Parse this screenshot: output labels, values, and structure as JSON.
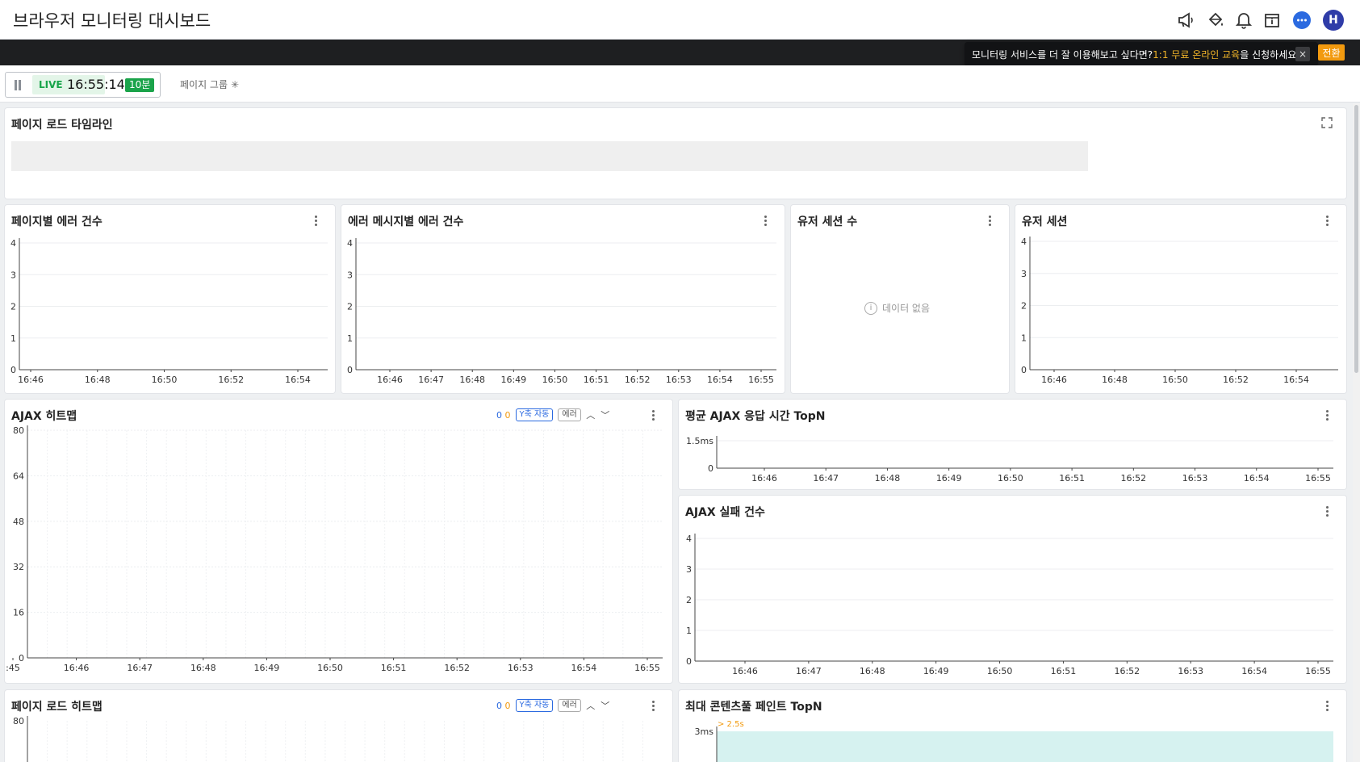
{
  "header": {
    "title": "브라우저 모니터링 대시보드",
    "icons": [
      "megaphone-icon",
      "paint-bucket-icon",
      "bell-icon",
      "calendar-icon",
      "chat-icon"
    ],
    "avatar_letter": "H"
  },
  "toast": {
    "text_before": "모니터링 서비스를 더 잘 이용해보고 싶다면? ",
    "highlight": "1:1 무료 온라인 교육",
    "text_after": "을 신청하세요",
    "close": "×",
    "side_button": "전환"
  },
  "toolbar": {
    "live_label": "LIVE",
    "time": "16:55:14",
    "range": "10분",
    "page_group_label": "페이지 그룹",
    "page_group_icon": "✳"
  },
  "cards": {
    "timeline": {
      "title": "페이지 로드 타임라인"
    },
    "page_errors": {
      "title": "페이지별 에러 건수"
    },
    "msg_errors": {
      "title": "에러 메시지별 에러 건수"
    },
    "session_count": {
      "title": "유저 세션 수",
      "no_data": "데이터 없음"
    },
    "sessions": {
      "title": "유저 세션"
    },
    "ajax_heatmap": {
      "title": "AJAX 히트맵",
      "count_a": "0",
      "count_b": "0",
      "y_auto": "Y축 자동",
      "error": "에러"
    },
    "ajax_avg": {
      "title": "평균 AJAX 응답 시간 TopN"
    },
    "ajax_fail": {
      "title": "AJAX 실패 건수"
    },
    "pl_heatmap": {
      "title": "페이지 로드 히트맵",
      "count_a": "0",
      "count_b": "0",
      "y_auto": "Y축 자동",
      "error": "에러"
    },
    "lcp": {
      "title": "최대 콘텐츠풀 페인트 TopN",
      "threshold": "> 2.5s"
    }
  },
  "chart_data": [
    {
      "type": "line",
      "name": "페이지별 에러 건수",
      "x": [
        "16:46",
        "16:48",
        "16:50",
        "16:52",
        "16:54"
      ],
      "ylim": [
        0,
        4
      ],
      "yticks": [
        "0",
        "1",
        "2",
        "3",
        "4"
      ],
      "series": []
    },
    {
      "type": "line",
      "name": "에러 메시지별 에러 건수",
      "x": [
        "16:46",
        "16:47",
        "16:48",
        "16:49",
        "16:50",
        "16:51",
        "16:52",
        "16:53",
        "16:54",
        "16:55"
      ],
      "ylim": [
        0,
        4
      ],
      "yticks": [
        "0",
        "1",
        "2",
        "3",
        "4"
      ],
      "series": []
    },
    {
      "type": "line",
      "name": "유저 세션",
      "x": [
        "16:46",
        "16:48",
        "16:50",
        "16:52",
        "16:54"
      ],
      "ylim": [
        0,
        4
      ],
      "yticks": [
        "0",
        "1",
        "2",
        "3",
        "4"
      ],
      "series": []
    },
    {
      "type": "heatmap",
      "name": "AJAX 히트맵",
      "x": [
        ":45",
        "16:46",
        "16:47",
        "16:48",
        "16:49",
        "16:50",
        "16:51",
        "16:52",
        "16:53",
        "16:54",
        "16:55"
      ],
      "ylim": [
        0,
        80
      ],
      "yticks": [
        "0",
        "16",
        "32",
        "48",
        "64",
        "80"
      ],
      "values": []
    },
    {
      "type": "line",
      "name": "평균 AJAX 응답 시간 TopN",
      "x": [
        "16:46",
        "16:47",
        "16:48",
        "16:49",
        "16:50",
        "16:51",
        "16:52",
        "16:53",
        "16:54",
        "16:55"
      ],
      "yticks": [
        "0",
        "1.5ms"
      ],
      "series": []
    },
    {
      "type": "line",
      "name": "AJAX 실패 건수",
      "x": [
        "16:46",
        "16:47",
        "16:48",
        "16:49",
        "16:50",
        "16:51",
        "16:52",
        "16:53",
        "16:54",
        "16:55"
      ],
      "ylim": [
        0,
        4
      ],
      "yticks": [
        "0",
        "1",
        "2",
        "3",
        "4"
      ],
      "series": []
    },
    {
      "type": "heatmap",
      "name": "페이지 로드 히트맵",
      "yticks": [
        "80"
      ],
      "values": []
    },
    {
      "type": "bar",
      "name": "최대 콘텐츠풀 페인트 TopN",
      "yticks": [
        "3ms"
      ],
      "series": []
    }
  ]
}
